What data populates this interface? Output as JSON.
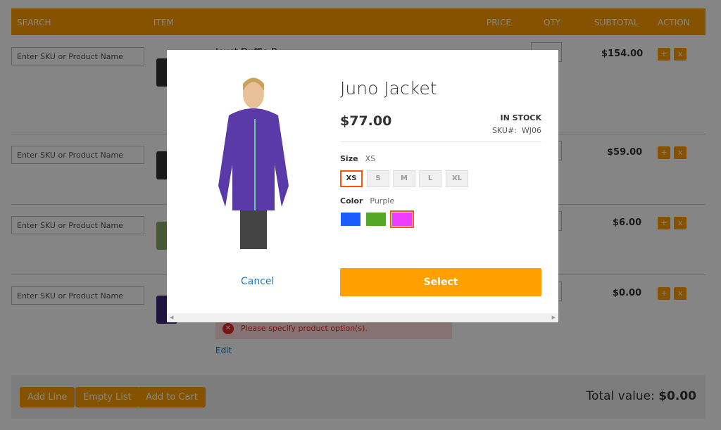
{
  "header": {
    "search": "SEARCH",
    "item": "ITEM",
    "price": "PRICE",
    "qty": "QTY",
    "subtotal": "SUBTOTAL",
    "action": "ACTION"
  },
  "rows": [
    {
      "placeholder": "Enter SKU or Product Name",
      "item": "Joust Duffle B",
      "subtotal": "$154.00"
    },
    {
      "placeholder": "Enter SKU or Product Name",
      "item": "",
      "subtotal": "$59.00"
    },
    {
      "placeholder": "Enter SKU or Product Name",
      "item": "",
      "subtotal": "$6.00"
    },
    {
      "placeholder": "Enter SKU or Product Name",
      "item": "",
      "subtotal": "$0.00",
      "error": "Please specify product option(s).",
      "edit": "Edit"
    }
  ],
  "action_add": "+",
  "action_remove": "x",
  "footer": {
    "add_line": "Add Line",
    "empty_list": "Empty List",
    "add_to_cart": "Add to Cart",
    "total_label": "Total value:",
    "total_value": "$0.00"
  },
  "modal": {
    "title": "Juno Jacket",
    "price": "$77.00",
    "stock": "IN STOCK",
    "sku_label": "SKU#:",
    "sku": "WJ06",
    "size_label": "Size",
    "size_selected": "XS",
    "sizes": [
      "XS",
      "S",
      "M",
      "L",
      "XL"
    ],
    "color_label": "Color",
    "color_selected": "Purple",
    "colors": [
      "#1a5cff",
      "#53a828",
      "#ef3dff"
    ],
    "cancel": "Cancel",
    "select": "Select"
  },
  "accent": "#ff9f00"
}
